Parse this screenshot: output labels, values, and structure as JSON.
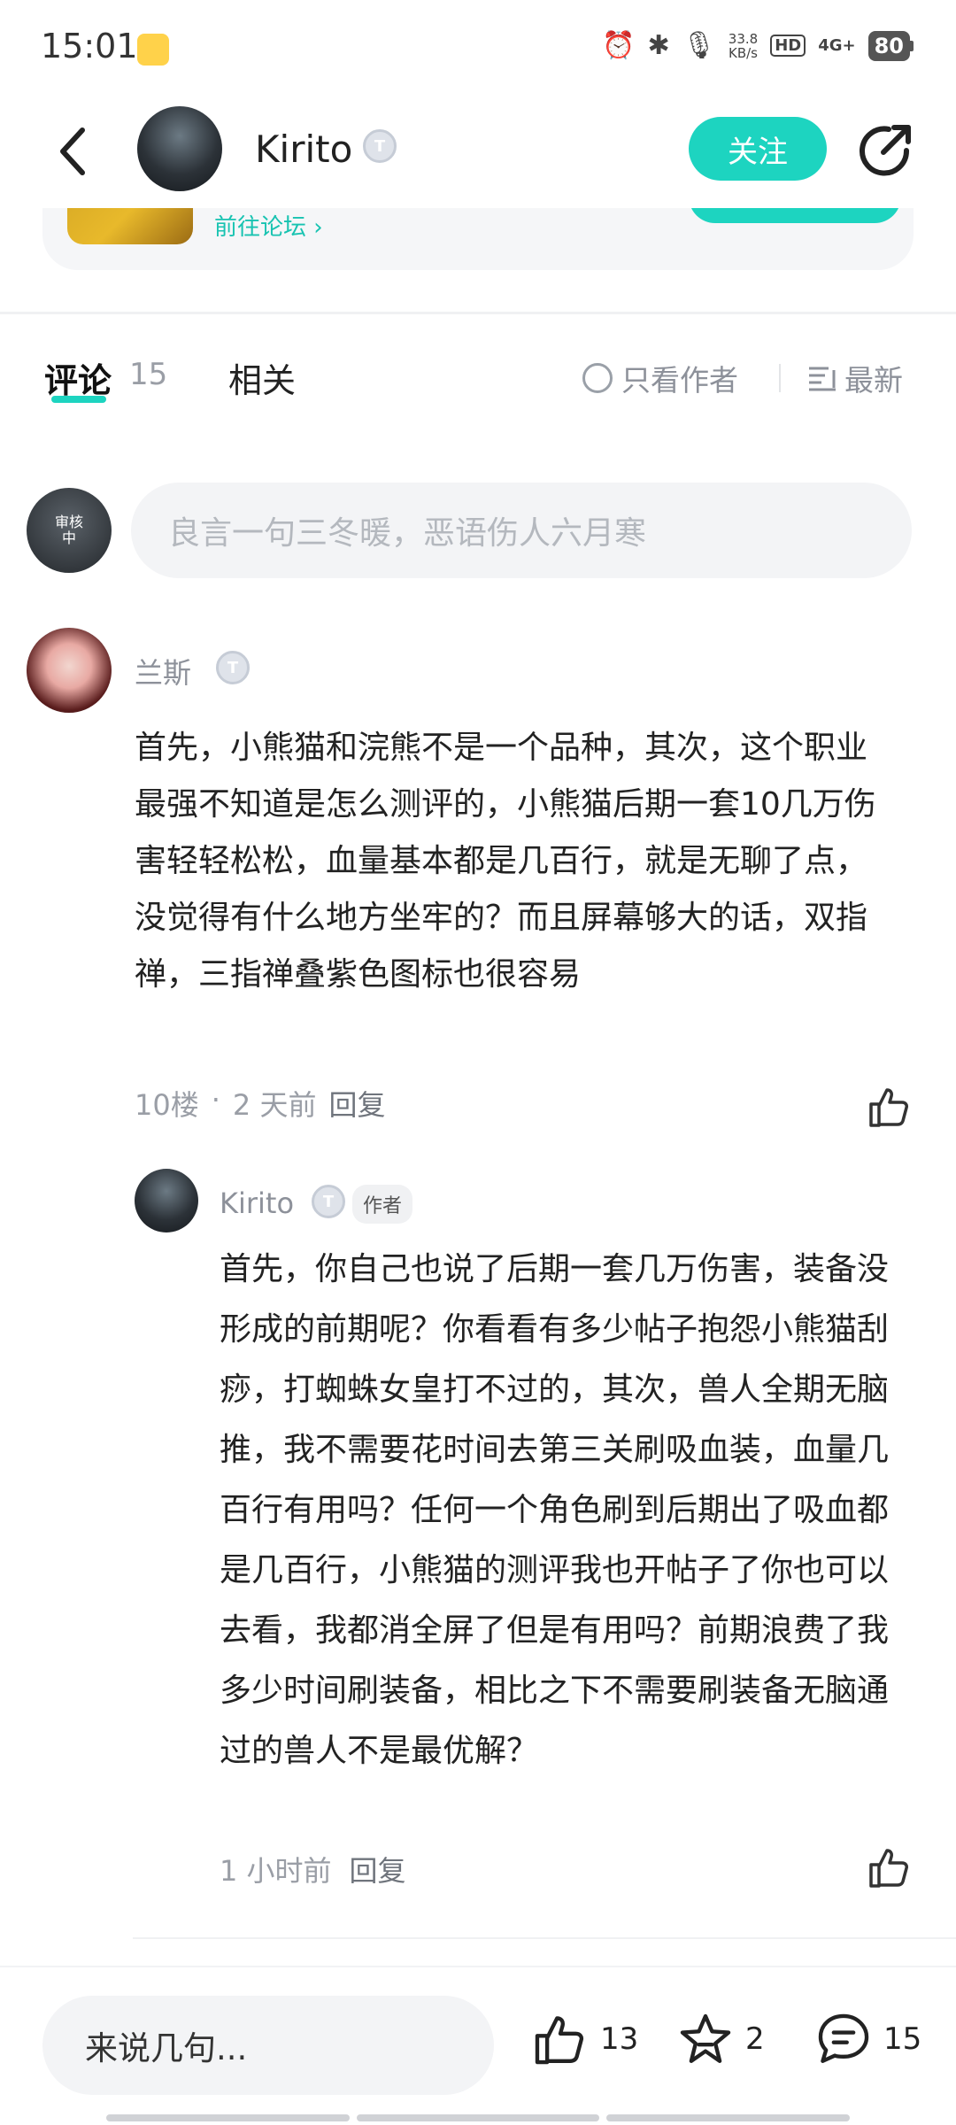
{
  "status_bar": {
    "time": "15:01",
    "net_speed_value": "33.8",
    "net_speed_unit": "KB/s",
    "hd": "HD",
    "network": "4G+",
    "battery": "80"
  },
  "header": {
    "user_name": "Kirito",
    "level_badge": "T",
    "follow_label": "关注"
  },
  "forum_card": {
    "link_label": "前往论坛 ›"
  },
  "tabs": {
    "comments_label": "评论",
    "comments_count": "15",
    "related_label": "相关",
    "author_only_label": "只看作者",
    "sort_label": "最新"
  },
  "comment_box": {
    "avatar_text": "审核中",
    "placeholder": "良言一句三冬暖，恶语伤人六月寒"
  },
  "comment": {
    "user_name": "兰斯",
    "level_badge": "T",
    "text": "首先，小熊猫和浣熊不是一个品种，其次，这个职业最强不知道是怎么测评的，小熊猫后期一套10几万伤害轻轻松松，血量基本都是几百行，就是无聊了点，没觉得有什么地方坐牢的？而且屏幕够大的话，双指禅，三指禅叠紫色图标也很容易",
    "floor": "10楼",
    "dot": "·",
    "time": "2 天前",
    "reply_label": "回复"
  },
  "reply": {
    "user_name": "Kirito",
    "level_badge": "T",
    "author_tag": "作者",
    "text": "首先，你自己也说了后期一套几万伤害，装备没形成的前期呢？你看看有多少帖子抱怨小熊猫刮痧，打蜘蛛女皇打不过的，其次，兽人全期无脑推，我不需要花时间去第三关刷吸血装，血量几百行有用吗？任何一个角色刷到后期出了吸血都是几百行，小熊猫的测评我也开帖子了你也可以去看，我都消全屏了但是有用吗？前期浪费了我多少时间刷装备，相比之下不需要刷装备无脑通过的兽人不是最优解？",
    "time": "1 小时前",
    "reply_label": "回复"
  },
  "bottom_bar": {
    "input_placeholder": "来说几句...",
    "like_count": "13",
    "fav_count": "2",
    "comment_count": "15"
  },
  "colors": {
    "accent": "#1dd4c0",
    "muted_text": "#9a9ea6"
  }
}
